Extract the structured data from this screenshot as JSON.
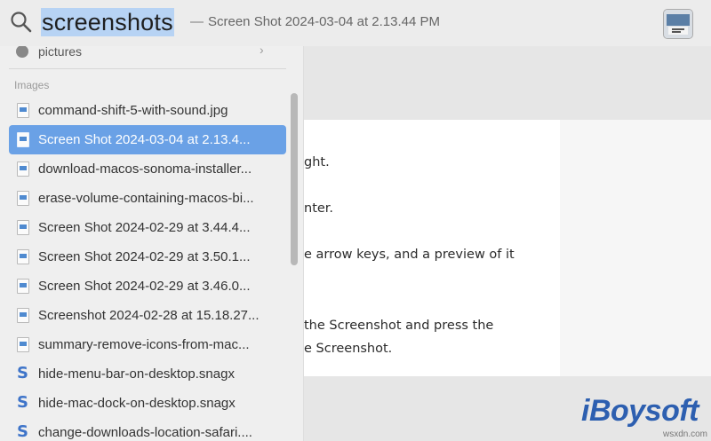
{
  "search": {
    "query": "screenshots",
    "separator": "—",
    "subtitle": "Screen Shot 2024-03-04 at 2.13.44 PM"
  },
  "sidebar": {
    "category_above": "pictures",
    "section_header": "Images",
    "results": [
      {
        "label": "command-shift-5-with-sound.jpg",
        "icon": "image-file-icon",
        "selected": false
      },
      {
        "label": "Screen Shot 2024-03-04 at 2.13.4...",
        "icon": "image-file-icon",
        "selected": true
      },
      {
        "label": "download-macos-sonoma-installer...",
        "icon": "image-file-icon",
        "selected": false
      },
      {
        "label": "erase-volume-containing-macos-bi...",
        "icon": "image-file-icon",
        "selected": false
      },
      {
        "label": "Screen Shot 2024-02-29 at 3.44.4...",
        "icon": "image-file-icon",
        "selected": false
      },
      {
        "label": "Screen Shot 2024-02-29 at 3.50.1...",
        "icon": "image-file-icon",
        "selected": false
      },
      {
        "label": "Screen Shot 2024-02-29 at 3.46.0...",
        "icon": "image-file-icon",
        "selected": false
      },
      {
        "label": "Screenshot 2024-02-28 at 15.18.27...",
        "icon": "image-file-icon",
        "selected": false
      },
      {
        "label": "summary-remove-icons-from-mac...",
        "icon": "image-file-icon",
        "selected": false
      },
      {
        "label": "hide-menu-bar-on-desktop.snagx",
        "icon": "snagit-file-icon",
        "selected": false
      },
      {
        "label": "hide-mac-dock-on-desktop.snagx",
        "icon": "snagit-file-icon",
        "selected": false
      },
      {
        "label": "change-downloads-location-safari....",
        "icon": "snagit-file-icon",
        "selected": false
      }
    ]
  },
  "preview": {
    "lines": [
      "ght.",
      "nter.",
      "e arrow keys, and a preview of it",
      " the Screenshot and press the",
      "e Screenshot."
    ]
  },
  "watermark": {
    "brand": "iBoysoft",
    "domain": "wsxdn.com"
  },
  "colors": {
    "selection": "#6aa1e6",
    "query_highlight": "#b7d3f4",
    "brand": "#2d5fb0"
  }
}
